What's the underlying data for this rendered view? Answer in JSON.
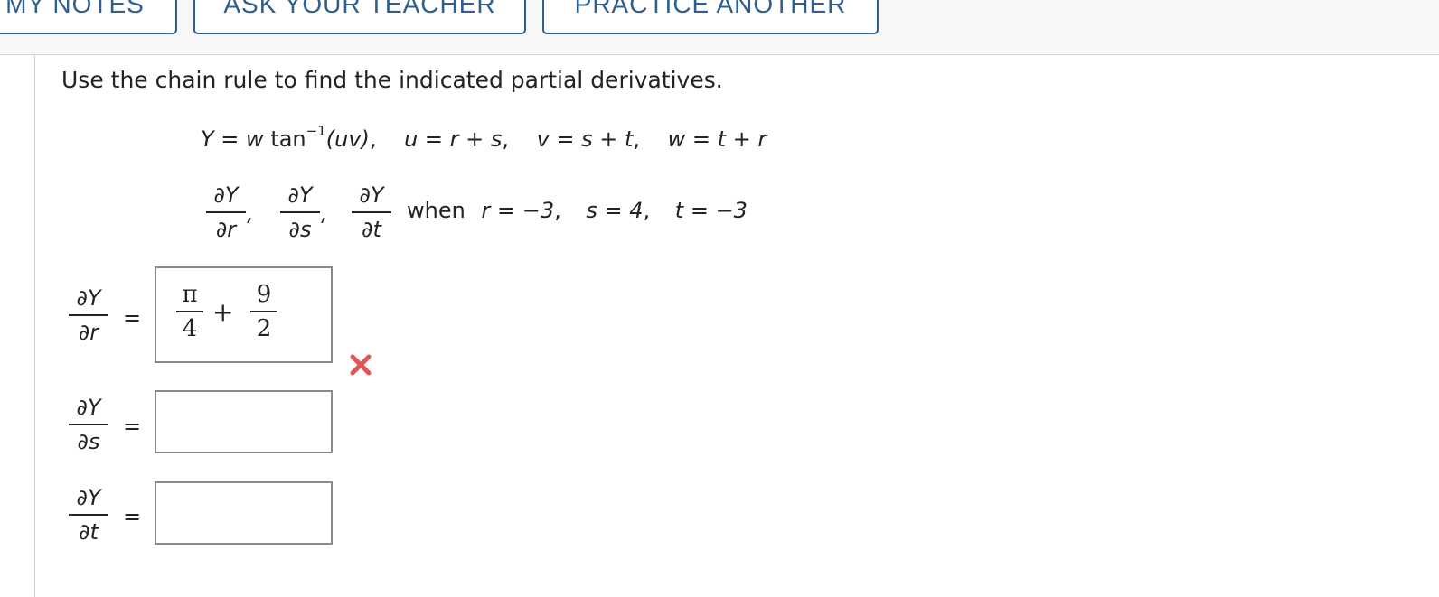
{
  "toolbar": {
    "my_notes": "MY NOTES",
    "ask_teacher": "ASK YOUR TEACHER",
    "practice_another": "PRACTICE ANOTHER"
  },
  "problem": {
    "instruction": "Use the chain rule to find the indicated partial derivatives.",
    "equation": {
      "lhs": "Y",
      "eq": " = ",
      "w": "w",
      "tan": " tan",
      "inv": "−1",
      "arg": "(uv)",
      "sep1": ",    ",
      "u_def": "u = r + s",
      "sep2": ",    ",
      "v_def": "v = s + t",
      "sep3": ",    ",
      "w_def": "w = t + r"
    },
    "targets": [
      {
        "num": "∂Y",
        "den": "∂r"
      },
      {
        "num": "∂Y",
        "den": "∂s"
      },
      {
        "num": "∂Y",
        "den": "∂t"
      }
    ],
    "when": {
      "label": "when",
      "r": "r = −3",
      "s": "s = 4",
      "t": "t = −3"
    }
  },
  "answers": [
    {
      "label_num": "∂Y",
      "label_den": "∂r",
      "equals": "=",
      "value": {
        "frac1_num": "π",
        "frac1_den": "4",
        "plus": "+",
        "frac2_num": "9",
        "frac2_den": "2"
      },
      "status": "incorrect"
    },
    {
      "label_num": "∂Y",
      "label_den": "∂s",
      "equals": "=",
      "value": "",
      "status": "empty"
    },
    {
      "label_num": "∂Y",
      "label_den": "∂t",
      "equals": "=",
      "value": "",
      "status": "empty"
    }
  ],
  "colors": {
    "button_border": "#2e5f91",
    "incorrect_mark": "#e05555"
  },
  "icons": {
    "incorrect": "x-mark-icon"
  }
}
